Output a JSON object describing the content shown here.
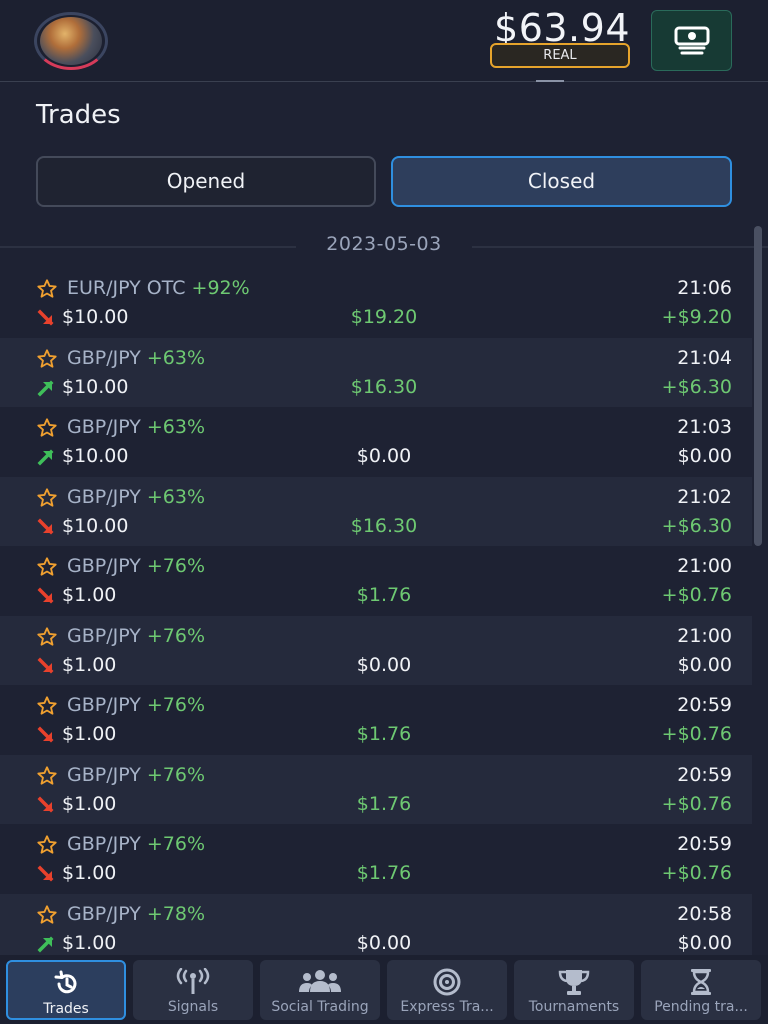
{
  "header": {
    "balance": "$63.94",
    "account_mode": "REAL",
    "cashier_icon": "cash-stack-icon"
  },
  "page": {
    "title": "Trades"
  },
  "tabs": {
    "opened": "Opened",
    "closed": "Closed",
    "active": "closed"
  },
  "date_group": "2023-05-03",
  "trades": [
    {
      "pair": "EUR/JPY OTC",
      "payout_pct": "+92%",
      "time": "21:06",
      "direction": "down",
      "amount": "$10.00",
      "payout": "$19.20",
      "profit": "+$9.20",
      "win": true
    },
    {
      "pair": "GBP/JPY",
      "payout_pct": "+63%",
      "time": "21:04",
      "direction": "up",
      "amount": "$10.00",
      "payout": "$16.30",
      "profit": "+$6.30",
      "win": true
    },
    {
      "pair": "GBP/JPY",
      "payout_pct": "+63%",
      "time": "21:03",
      "direction": "up",
      "amount": "$10.00",
      "payout": "$0.00",
      "profit": "$0.00",
      "win": false
    },
    {
      "pair": "GBP/JPY",
      "payout_pct": "+63%",
      "time": "21:02",
      "direction": "down",
      "amount": "$10.00",
      "payout": "$16.30",
      "profit": "+$6.30",
      "win": true
    },
    {
      "pair": "GBP/JPY",
      "payout_pct": "+76%",
      "time": "21:00",
      "direction": "down",
      "amount": "$1.00",
      "payout": "$1.76",
      "profit": "+$0.76",
      "win": true
    },
    {
      "pair": "GBP/JPY",
      "payout_pct": "+76%",
      "time": "21:00",
      "direction": "down",
      "amount": "$1.00",
      "payout": "$0.00",
      "profit": "$0.00",
      "win": false
    },
    {
      "pair": "GBP/JPY",
      "payout_pct": "+76%",
      "time": "20:59",
      "direction": "down",
      "amount": "$1.00",
      "payout": "$1.76",
      "profit": "+$0.76",
      "win": true
    },
    {
      "pair": "GBP/JPY",
      "payout_pct": "+76%",
      "time": "20:59",
      "direction": "down",
      "amount": "$1.00",
      "payout": "$1.76",
      "profit": "+$0.76",
      "win": true
    },
    {
      "pair": "GBP/JPY",
      "payout_pct": "+76%",
      "time": "20:59",
      "direction": "down",
      "amount": "$1.00",
      "payout": "$1.76",
      "profit": "+$0.76",
      "win": true
    },
    {
      "pair": "GBP/JPY",
      "payout_pct": "+78%",
      "time": "20:58",
      "direction": "up",
      "amount": "$1.00",
      "payout": "$0.00",
      "profit": "$0.00",
      "win": false
    }
  ],
  "bottom_nav": [
    {
      "label": "Trades",
      "icon": "history-icon",
      "active": true
    },
    {
      "label": "Signals",
      "icon": "signal-tower-icon",
      "active": false
    },
    {
      "label": "Social Trading",
      "icon": "people-icon",
      "active": false
    },
    {
      "label": "Express Tra...",
      "icon": "target-icon",
      "active": false
    },
    {
      "label": "Tournaments",
      "icon": "trophy-icon",
      "active": false
    },
    {
      "label": "Pending tra...",
      "icon": "hourglass-icon",
      "active": false
    }
  ],
  "colors": {
    "accent_blue": "#2f8fe0",
    "win_green": "#6ec972",
    "down_red": "#e8412c",
    "up_green": "#3fbf5a",
    "star_orange": "#f0a030",
    "real_badge": "#e6a42c"
  }
}
